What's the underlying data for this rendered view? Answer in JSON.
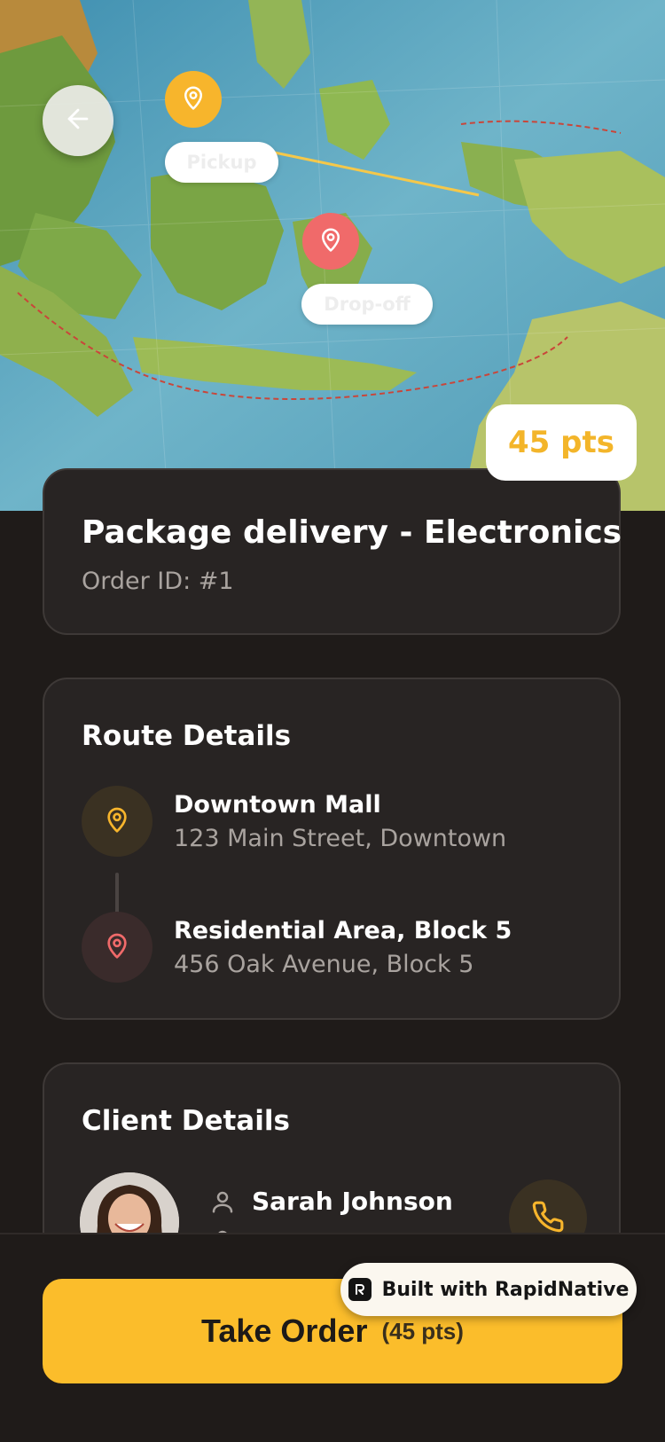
{
  "map": {
    "pickup_label": "Pickup",
    "dropoff_label": "Drop-off",
    "points_badge": "45 pts"
  },
  "order": {
    "title": "Package delivery - Electronics",
    "order_id": "Order ID: #1"
  },
  "route": {
    "section_title": "Route Details",
    "pickup": {
      "name": "Downtown Mall",
      "address": "123 Main Street, Downtown"
    },
    "dropoff": {
      "name": "Residential Area, Block 5",
      "address": "456 Oak Avenue, Block 5"
    }
  },
  "client": {
    "section_title": "Client Details",
    "name": "Sarah Johnson"
  },
  "action": {
    "label": "Take Order",
    "points": "(45 pts)"
  },
  "built_with": "Built with RapidNative",
  "colors": {
    "accent": "#fbbd2b",
    "dropoff": "#f06a6a",
    "background": "#1f1b19",
    "card": "#282423"
  }
}
